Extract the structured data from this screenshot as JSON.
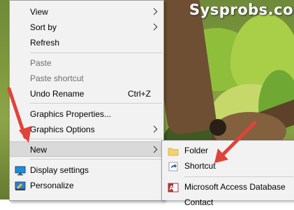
{
  "watermark": "Sysprobs.com",
  "context_menu": {
    "view": "View",
    "sort_by": "Sort by",
    "refresh": "Refresh",
    "paste": "Paste",
    "paste_shortcut": "Paste shortcut",
    "undo_rename": "Undo Rename",
    "undo_shortcut": "Ctrl+Z",
    "graphics_properties": "Graphics Properties...",
    "graphics_options": "Graphics Options",
    "new": "New",
    "display_settings": "Display settings",
    "personalize": "Personalize"
  },
  "new_submenu": {
    "folder": "Folder",
    "shortcut": "Shortcut",
    "access_db": "Microsoft Access Database",
    "partial": "Contact"
  },
  "colors": {
    "annotation_arrow": "#e0433a",
    "menu_bg": "#f2f2f2",
    "highlight_bg": "#d9d9d9",
    "folder_yellow": "#f3d36b",
    "access_red": "#a4373a",
    "monitor_blue": "#1b8fd6"
  },
  "icons": [
    "display-settings-icon",
    "personalize-icon",
    "folder-icon",
    "shortcut-icon",
    "access-database-icon"
  ]
}
